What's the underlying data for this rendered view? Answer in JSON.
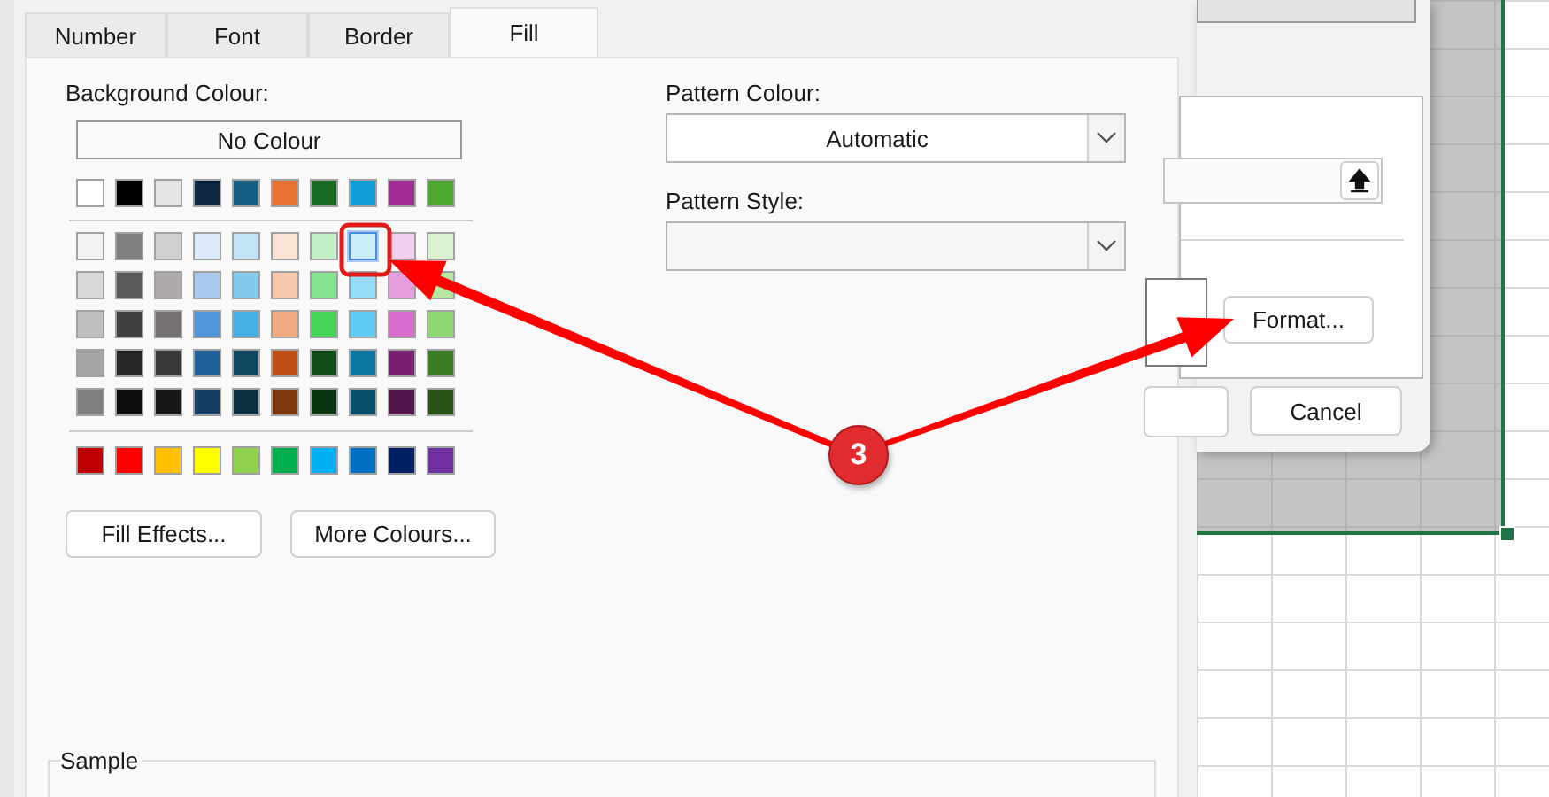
{
  "tabs": [
    {
      "label": "Number",
      "selected": false
    },
    {
      "label": "Font",
      "selected": false
    },
    {
      "label": "Border",
      "selected": false
    },
    {
      "label": "Fill",
      "selected": true
    }
  ],
  "background_colour": {
    "label": "Background Colour:",
    "no_colour_button": "No Colour",
    "theme_colours": [
      {
        "color": "#ffffff",
        "selected": false
      },
      {
        "color": "#000000",
        "selected": false
      },
      {
        "color": "#e7e6e6",
        "selected": false
      },
      {
        "color": "#0e2841",
        "selected": false
      },
      {
        "color": "#156082",
        "selected": false
      },
      {
        "color": "#e97132",
        "selected": false
      },
      {
        "color": "#196b24",
        "selected": false
      },
      {
        "color": "#0f9ed5",
        "selected": false
      },
      {
        "color": "#a02b93",
        "selected": false
      },
      {
        "color": "#4ea72e",
        "selected": false
      }
    ],
    "shade_rows": [
      {
        "swatches": [
          {
            "color": "#f2f2f2",
            "selected": false
          },
          {
            "color": "#7f7f7f",
            "selected": false
          },
          {
            "color": "#d0d0d0",
            "selected": false
          },
          {
            "color": "#dceaf7",
            "selected": false
          },
          {
            "color": "#c0e4f5",
            "selected": false
          },
          {
            "color": "#fbe3d6",
            "selected": false
          },
          {
            "color": "#c1f0c8",
            "selected": false
          },
          {
            "color": "#cbeef8",
            "selected": true
          },
          {
            "color": "#f2cfee",
            "selected": false
          },
          {
            "color": "#daf2d0",
            "selected": false
          }
        ]
      },
      {
        "swatches": [
          {
            "color": "#d9d9d9",
            "selected": false
          },
          {
            "color": "#595959",
            "selected": false
          },
          {
            "color": "#aeaaaa",
            "selected": false
          },
          {
            "color": "#a6c9ec",
            "selected": false
          },
          {
            "color": "#83cbeb",
            "selected": false
          },
          {
            "color": "#f7c7ac",
            "selected": false
          },
          {
            "color": "#83e28e",
            "selected": false
          },
          {
            "color": "#95dcf7",
            "selected": false
          },
          {
            "color": "#e59ede",
            "selected": false
          },
          {
            "color": "#b5e6a2",
            "selected": false
          }
        ]
      },
      {
        "swatches": [
          {
            "color": "#bfbfbf",
            "selected": false
          },
          {
            "color": "#404040",
            "selected": false
          },
          {
            "color": "#757171",
            "selected": false
          },
          {
            "color": "#4e95d9",
            "selected": false
          },
          {
            "color": "#45b0e1",
            "selected": false
          },
          {
            "color": "#f1a983",
            "selected": false
          },
          {
            "color": "#47d45a",
            "selected": false
          },
          {
            "color": "#61cbf3",
            "selected": false
          },
          {
            "color": "#d86dcd",
            "selected": false
          },
          {
            "color": "#8ed973",
            "selected": false
          }
        ]
      },
      {
        "swatches": [
          {
            "color": "#a6a6a6",
            "selected": false
          },
          {
            "color": "#262626",
            "selected": false
          },
          {
            "color": "#3a3838",
            "selected": false
          },
          {
            "color": "#215f9a",
            "selected": false
          },
          {
            "color": "#104862",
            "selected": false
          },
          {
            "color": "#c04f15",
            "selected": false
          },
          {
            "color": "#124f1a",
            "selected": false
          },
          {
            "color": "#0b769f",
            "selected": false
          },
          {
            "color": "#782170",
            "selected": false
          },
          {
            "color": "#3b7d23",
            "selected": false
          }
        ]
      },
      {
        "swatches": [
          {
            "color": "#7f7f7f",
            "selected": false
          },
          {
            "color": "#0d0d0d",
            "selected": false
          },
          {
            "color": "#171717",
            "selected": false
          },
          {
            "color": "#163e64",
            "selected": false
          },
          {
            "color": "#0a2f41",
            "selected": false
          },
          {
            "color": "#7d370d",
            "selected": false
          },
          {
            "color": "#0c3511",
            "selected": false
          },
          {
            "color": "#074f69",
            "selected": false
          },
          {
            "color": "#501549",
            "selected": false
          },
          {
            "color": "#275317",
            "selected": false
          }
        ]
      }
    ],
    "standard_colours": [
      {
        "color": "#c00000",
        "selected": false
      },
      {
        "color": "#ff0000",
        "selected": false
      },
      {
        "color": "#ffc000",
        "selected": false
      },
      {
        "color": "#ffff00",
        "selected": false
      },
      {
        "color": "#92d050",
        "selected": false
      },
      {
        "color": "#00b050",
        "selected": false
      },
      {
        "color": "#00b0f0",
        "selected": false
      },
      {
        "color": "#0070c0",
        "selected": false
      },
      {
        "color": "#002060",
        "selected": false
      },
      {
        "color": "#7030a0",
        "selected": false
      }
    ],
    "buttons": [
      "Fill Effects...",
      "More Colours..."
    ]
  },
  "pattern_colour": {
    "label": "Pattern Colour:",
    "value": "Automatic"
  },
  "pattern_style": {
    "label": "Pattern Style:"
  },
  "sample": {
    "label": "Sample"
  },
  "back_dialog": {
    "format_button": "Format...",
    "cancel_button": "Cancel"
  },
  "annotation": {
    "label": "3"
  }
}
